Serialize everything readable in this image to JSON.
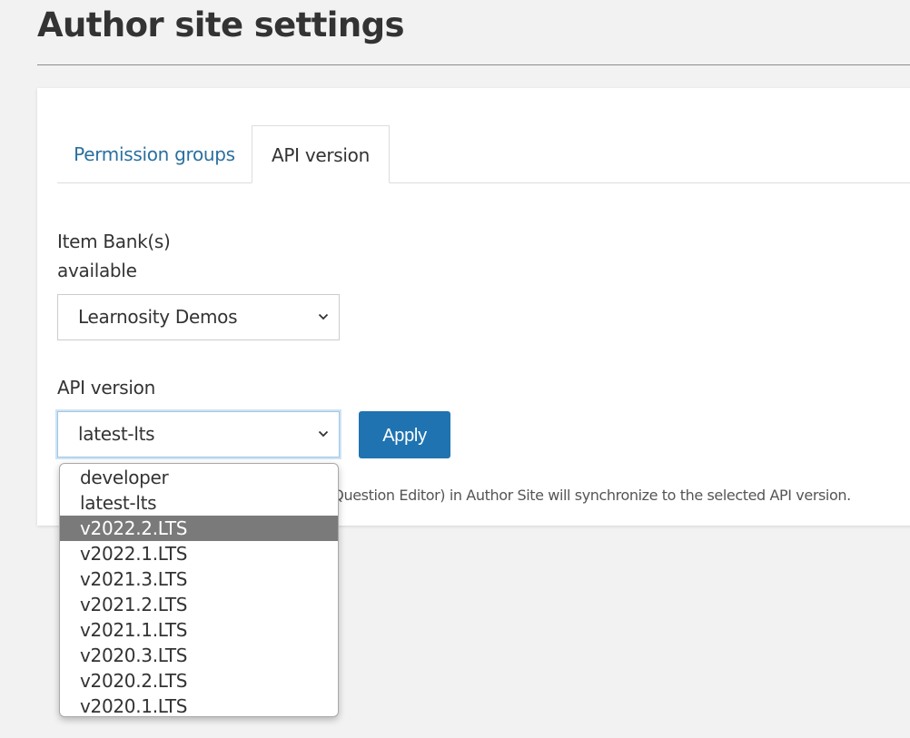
{
  "page": {
    "title": "Author site settings"
  },
  "tabs": [
    {
      "label": "Permission groups",
      "active": false
    },
    {
      "label": "API version",
      "active": true
    }
  ],
  "item_bank": {
    "label_line1": "Item Bank(s)",
    "label_line2": "available",
    "selected": "Learnosity Demos"
  },
  "api_version": {
    "label": "API version",
    "selected": "latest-lts",
    "apply_label": "Apply",
    "help_text_visible": "s, Question Editor) in Author Site will synchronize to the selected API version.",
    "options": [
      "developer",
      "latest-lts",
      "v2022.2.LTS",
      "v2022.1.LTS",
      "v2021.3.LTS",
      "v2021.2.LTS",
      "v2021.1.LTS",
      "v2020.3.LTS",
      "v2020.2.LTS",
      "v2020.1.LTS"
    ],
    "highlighted_option": "v2022.2.LTS"
  },
  "colors": {
    "link": "#2a6f9e",
    "primary_button": "#1f73b0",
    "highlight": "#7a7a7a"
  }
}
